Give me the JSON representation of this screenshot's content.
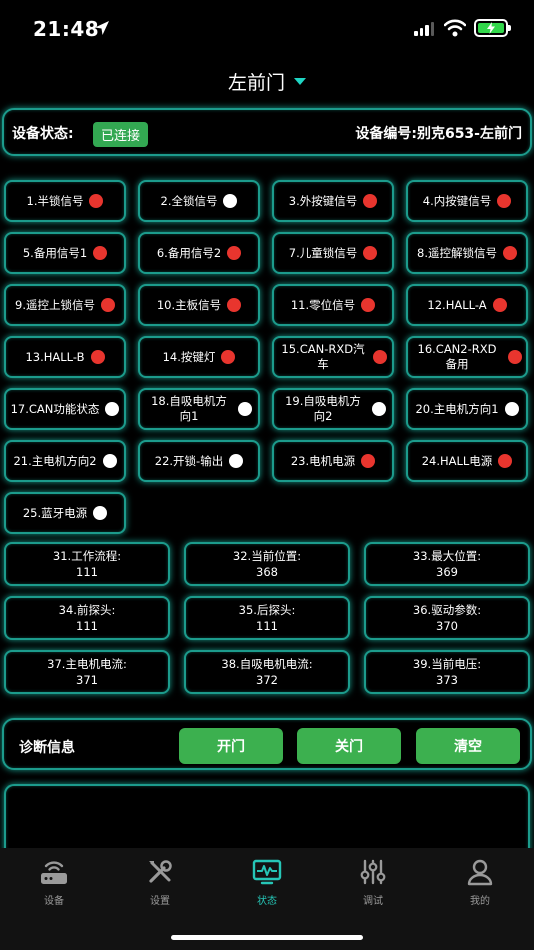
{
  "status_bar": {
    "time": "21:48"
  },
  "header": {
    "title": "左前门"
  },
  "device": {
    "status_label": "设备状态:",
    "status_badge": "已连接",
    "number_label": "设备编号:",
    "number_value": "别克653-左前门"
  },
  "signals": [
    {
      "label": "1.半锁信号",
      "state": "red"
    },
    {
      "label": "2.全锁信号",
      "state": "white"
    },
    {
      "label": "3.外按键信号",
      "state": "red"
    },
    {
      "label": "4.内按键信号",
      "state": "red"
    },
    {
      "label": "5.备用信号1",
      "state": "red"
    },
    {
      "label": "6.备用信号2",
      "state": "red"
    },
    {
      "label": "7.儿童锁信号",
      "state": "red"
    },
    {
      "label": "8.遥控解锁信号",
      "state": "red"
    },
    {
      "label": "9.遥控上锁信号",
      "state": "red"
    },
    {
      "label": "10.主板信号",
      "state": "red"
    },
    {
      "label": "11.零位信号",
      "state": "red"
    },
    {
      "label": "12.HALL-A",
      "state": "red"
    },
    {
      "label": "13.HALL-B",
      "state": "red"
    },
    {
      "label": "14.按键灯",
      "state": "red"
    },
    {
      "label": "15.CAN-RXD汽车",
      "state": "red"
    },
    {
      "label": "16.CAN2-RXD备用",
      "state": "red"
    },
    {
      "label": "17.CAN功能状态",
      "state": "white"
    },
    {
      "label": "18.自吸电机方向1",
      "state": "white"
    },
    {
      "label": "19.自吸电机方向2",
      "state": "white"
    },
    {
      "label": "20.主电机方向1",
      "state": "white"
    },
    {
      "label": "21.主电机方向2",
      "state": "white"
    },
    {
      "label": "22.开锁-输出",
      "state": "white"
    },
    {
      "label": "23.电机电源",
      "state": "red"
    },
    {
      "label": "24.HALL电源",
      "state": "red"
    },
    {
      "label": "25.蓝牙电源",
      "state": "white"
    }
  ],
  "values": [
    {
      "label": "31.工作流程:",
      "value": "111"
    },
    {
      "label": "32.当前位置:",
      "value": "368"
    },
    {
      "label": "33.最大位置:",
      "value": "369"
    },
    {
      "label": "34.前探头:",
      "value": "111"
    },
    {
      "label": "35.后探头:",
      "value": "111"
    },
    {
      "label": "36.驱动参数:",
      "value": "370"
    },
    {
      "label": "37.主电机电流:",
      "value": "371"
    },
    {
      "label": "38.自吸电机电流:",
      "value": "372"
    },
    {
      "label": "39.当前电压:",
      "value": "373"
    }
  ],
  "diagnostics": {
    "label": "诊断信息",
    "open_btn": "开门",
    "close_btn": "关门",
    "clear_btn": "清空"
  },
  "tabs": [
    {
      "label": "设备",
      "icon": "router-icon",
      "active": false
    },
    {
      "label": "设置",
      "icon": "tools-icon",
      "active": false
    },
    {
      "label": "状态",
      "icon": "monitor-icon",
      "active": true
    },
    {
      "label": "调试",
      "icon": "sliders-icon",
      "active": false
    },
    {
      "label": "我的",
      "icon": "user-icon",
      "active": false
    }
  ],
  "colors": {
    "accent": "#26c6b7",
    "indicator_red": "#e8352e",
    "button_green": "#3cb04f",
    "connected_badge": "#33a852"
  }
}
